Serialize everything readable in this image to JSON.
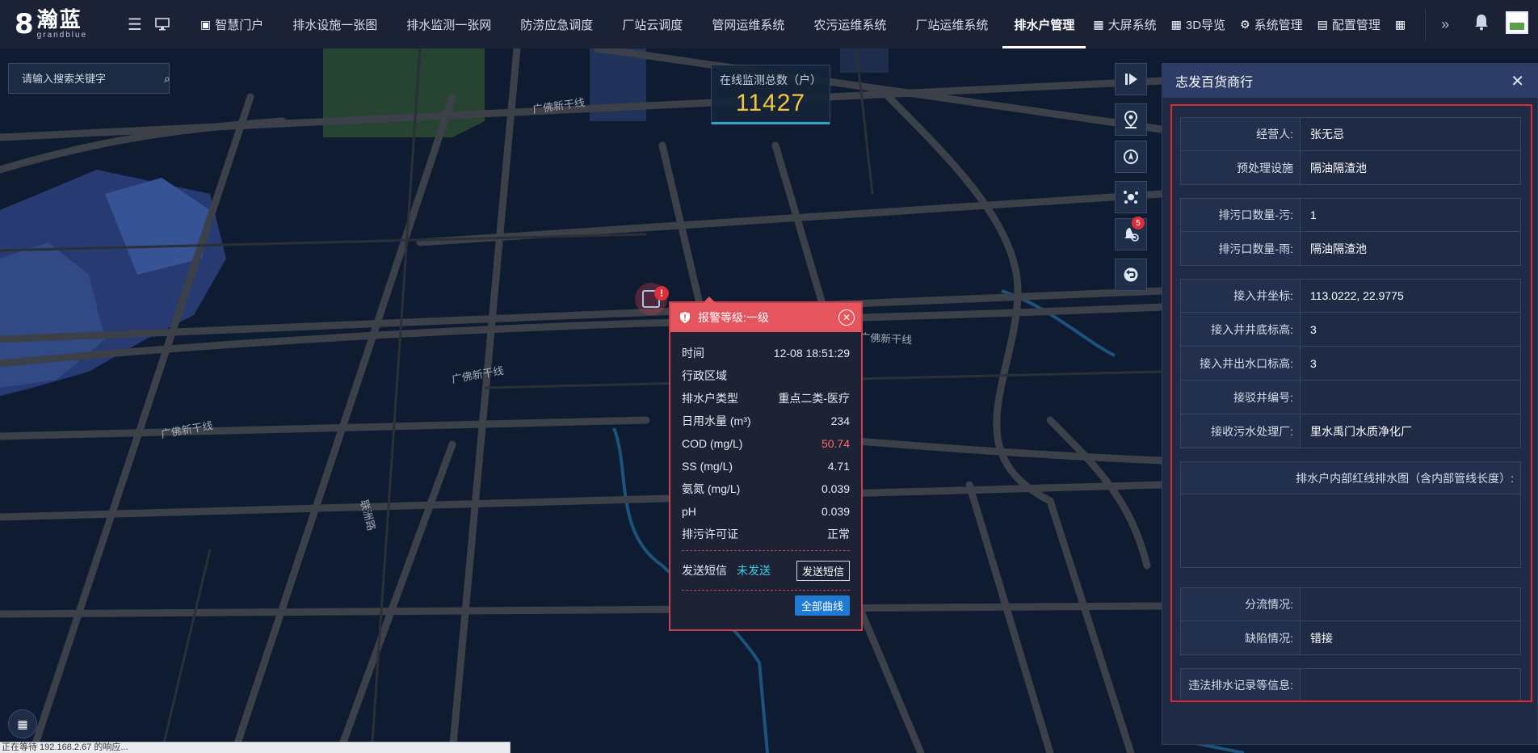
{
  "logo": {
    "mark": "8",
    "name_cn": "瀚蓝",
    "name_en": "grandblue"
  },
  "topbar": {
    "menu_icon": "menu-icon",
    "monitor_icon": "desktop-icon",
    "nav": [
      {
        "label": "智慧门户",
        "icon": "portal-icon",
        "active": false
      },
      {
        "label": "排水设施一张图",
        "active": false
      },
      {
        "label": "排水监测一张网",
        "active": false
      },
      {
        "label": "防涝应急调度",
        "active": false
      },
      {
        "label": "厂站云调度",
        "active": false
      },
      {
        "label": "管网运维系统",
        "active": false
      },
      {
        "label": "农污运维系统",
        "active": false
      },
      {
        "label": "厂站运维系统",
        "active": false
      },
      {
        "label": "排水户管理",
        "active": true
      },
      {
        "label": "大屏系统",
        "icon": "grid-icon",
        "active": false
      },
      {
        "label": "3D导览",
        "icon": "grid-icon",
        "active": false
      },
      {
        "label": "系统管理",
        "icon": "gear-icon",
        "active": false
      },
      {
        "label": "配置管理",
        "icon": "doc-icon",
        "active": false
      }
    ],
    "more_icon": "double-chevron-right-icon",
    "bell_icon": "bell-icon"
  },
  "search": {
    "placeholder": "请输入搜索关键字"
  },
  "monitor": {
    "label": "在线监测总数（户）",
    "value": "11427"
  },
  "map": {
    "road_labels": [
      "广佛新干线",
      "广佛新干线",
      "广佛新干线",
      "广佛新干线",
      "联洲路"
    ]
  },
  "tools": {
    "items": [
      "panel-toggle-icon",
      "location-pin-icon",
      "compass-icon",
      "cluster-icon",
      "alarm-bell-icon",
      "back-icon"
    ],
    "alarm_badge": "5"
  },
  "alarm_popup": {
    "title": "报警等级:一级",
    "rows": [
      {
        "key": "时间",
        "value": "12-08 18:51:29",
        "highlight": false
      },
      {
        "key": "行政区域",
        "value": "",
        "highlight": false
      },
      {
        "key": "排水户类型",
        "value": "重点二类-医疗",
        "highlight": false
      },
      {
        "key": "日用水量 (m³)",
        "value": "234",
        "highlight": false
      },
      {
        "key": "COD (mg/L)",
        "value": "50.74",
        "highlight": true
      },
      {
        "key": "SS (mg/L)",
        "value": "4.71",
        "highlight": false
      },
      {
        "key": "氨氮 (mg/L)",
        "value": "0.039",
        "highlight": false
      },
      {
        "key": "pH",
        "value": "0.039",
        "highlight": false
      },
      {
        "key": "排污许可证",
        "value": "正常",
        "highlight": false
      }
    ],
    "sms_label": "发送短信",
    "sms_status": "未发送",
    "sms_button": "发送短信",
    "curve_button": "全部曲线"
  },
  "panel": {
    "title": "志发百货商行",
    "groups": [
      [
        {
          "key": "经营人:",
          "value": "张无忌"
        },
        {
          "key": "预处理设施",
          "value": "隔油隔渣池"
        }
      ],
      [
        {
          "key": "排污口数量-污:",
          "value": "1"
        },
        {
          "key": "排污口数量-雨:",
          "value": "隔油隔渣池"
        }
      ],
      [
        {
          "key": "接入井坐标:",
          "value": "113.0222, 22.9775"
        },
        {
          "key": "接入井井底标高:",
          "value": "3"
        },
        {
          "key": "接入井出水口标高:",
          "value": "3"
        },
        {
          "key": "接驳井编号:",
          "value": ""
        },
        {
          "key": "接收污水处理厂:",
          "value": "里水禹门水质净化厂"
        }
      ]
    ],
    "drawing_label": "排水户内部红线排水图（含内部管线长度）:",
    "groups2": [
      [
        {
          "key": "分流情况:",
          "value": ""
        },
        {
          "key": "缺陷情况:",
          "value": "错接"
        }
      ],
      [
        {
          "key": "违法排水记录等信息:",
          "value": ""
        }
      ]
    ]
  },
  "statusbar": {
    "text": "正在等待 192.168.2.67 的响应..."
  },
  "colors": {
    "accent": "#1f7ad4",
    "alarm": "#e4555d",
    "highlight_border": "#e02a2a",
    "monitor_value": "#f6c53a",
    "sms_status": "#39d0e6"
  }
}
